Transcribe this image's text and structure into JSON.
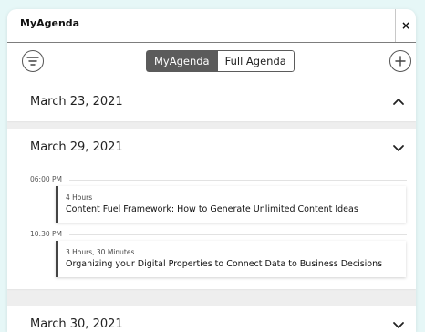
{
  "window": {
    "title": "MyAgenda",
    "close_label": "×"
  },
  "toolbar": {
    "filter_icon": "filter-lines-icon",
    "add_icon": "plus-icon",
    "toggle": {
      "active_label": "MyAgenda",
      "inactive_label": "Full Agenda"
    }
  },
  "days": [
    {
      "date": "March 23, 2021",
      "expanded": true,
      "chevron": "chevron-up-icon"
    },
    {
      "date": "March 29, 2021",
      "expanded": true,
      "chevron": "chevron-down-icon",
      "slots": [
        {
          "time": "06:00 PM",
          "duration": "4 Hours",
          "title": "Content Fuel Framework: How to Generate Unlimited Content Ideas"
        },
        {
          "time": "10:30 PM",
          "duration": "3 Hours, 30 Minutes",
          "title": "Organizing your Digital Properties to Connect Data to Business Decisions"
        }
      ]
    },
    {
      "date": "March 30, 2021",
      "expanded": false,
      "chevron": "chevron-down-icon"
    }
  ],
  "colors": {
    "background": "#e6f7f7",
    "toggle_active": "#5b5b5b",
    "session_accent": "#444444",
    "list_bg": "#eeeeee"
  }
}
